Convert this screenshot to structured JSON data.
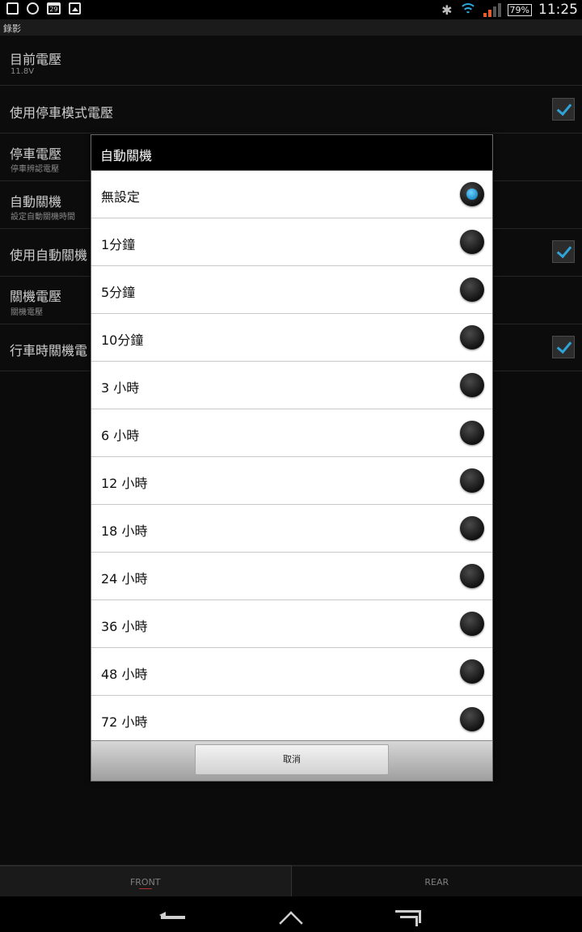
{
  "status_bar": {
    "calendar_day": "29",
    "battery": "79%",
    "time": "11:25",
    "icons": [
      "screenshot-icon",
      "sync-icon",
      "calendar-icon",
      "gallery-icon",
      "bluetooth-icon",
      "wifi-icon",
      "signal-icon",
      "battery-icon"
    ],
    "bluetooth_glyph": "✱"
  },
  "app": {
    "title": "錄影"
  },
  "settings": [
    {
      "title": "目前電壓",
      "subtitle": "11.8V",
      "checkbox": false
    },
    {
      "title": "使用停車模式電壓",
      "subtitle": "",
      "checkbox": true,
      "checked": true
    },
    {
      "title": "停車電壓",
      "subtitle": "停車辨認電壓",
      "checkbox": false
    },
    {
      "title": "自動關機",
      "subtitle": "設定自動關機時間",
      "checkbox": false
    },
    {
      "title": "使用自動關機",
      "subtitle": "",
      "checkbox": true,
      "checked": true
    },
    {
      "title": "關機電壓",
      "subtitle": "關機電壓",
      "checkbox": false
    },
    {
      "title": "行車時關機電",
      "subtitle": "",
      "checkbox": true,
      "checked": true
    }
  ],
  "dialog": {
    "title": "自動關機",
    "selected_index": 0,
    "options": [
      "無設定",
      "1分鐘",
      "5分鐘",
      "10分鐘",
      "3 小時",
      "6 小時",
      "12 小時",
      "18 小時",
      "24 小時",
      "36 小時",
      "48 小時",
      "72 小時"
    ],
    "cancel_label": "取消"
  },
  "tabs": [
    {
      "label": "FRONT"
    },
    {
      "label": "REAR"
    }
  ],
  "colors": {
    "accent": "#2fa3d6",
    "dialog_header": "#000000",
    "dialog_body": "#ffffff"
  }
}
